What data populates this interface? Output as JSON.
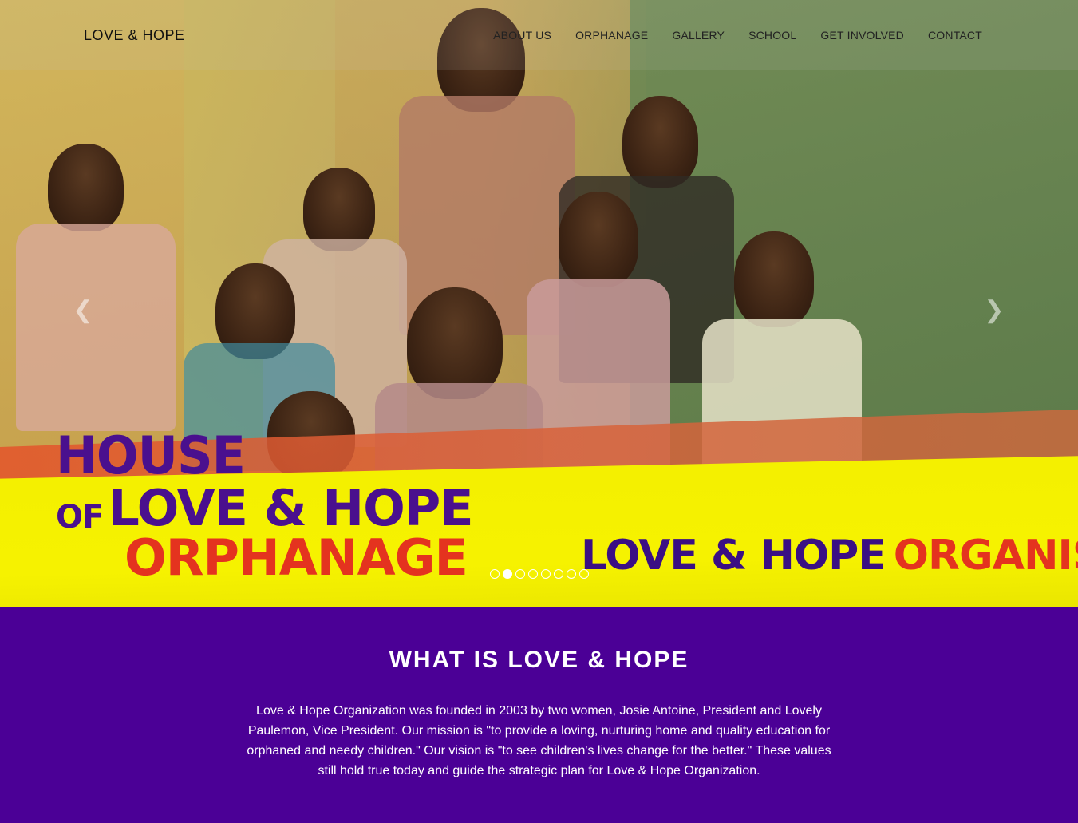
{
  "nav": {
    "brand": "LOVE & HOPE",
    "items": [
      {
        "label": "ABOUT US"
      },
      {
        "label": "ORPHANAGE"
      },
      {
        "label": "GALLERY"
      },
      {
        "label": "SCHOOL"
      },
      {
        "label": "GET INVOLVED"
      },
      {
        "label": "CONTACT"
      }
    ]
  },
  "hero": {
    "logo_line1": "HOUSE",
    "logo_of": "OF",
    "logo_line2": "LOVE & HOPE",
    "logo_line3": "ORPHANAGE",
    "org_name_a": "LOVE & HOPE",
    "org_name_b": "ORGANISATION",
    "prev_icon": "chevron-left-icon",
    "next_icon": "chevron-right-icon",
    "slide_count": 8,
    "active_slide": 2
  },
  "about": {
    "heading": "WHAT IS LOVE & HOPE",
    "body": "Love & Hope Organization was founded in 2003 by two women, Josie Antoine, President and Lovely Paulemon, Vice President. Our mission is \"to provide a loving, nurturing home and quality education for orphaned and needy children.\" Our vision is \"to see children's lives change for the better.\" These values still hold true today and guide the strategic plan for Love & Hope Organization."
  },
  "colors": {
    "accent_purple": "#4b0096",
    "logo_purple": "#4a108e",
    "logo_red": "#e4331f",
    "banner_yellow": "#f4f000"
  }
}
